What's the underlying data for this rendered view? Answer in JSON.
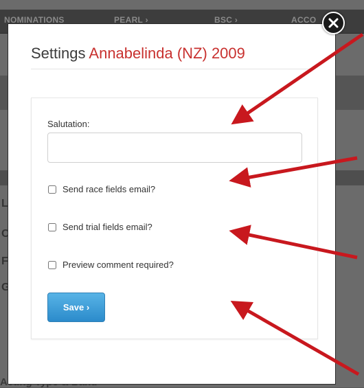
{
  "background": {
    "nav_items": [
      "NOMINATIONS",
      "PEARL ›",
      "BSC ›",
      "ACCO"
    ],
    "footer_text": "Acting Type & Band"
  },
  "modal": {
    "title_prefix": "Settings",
    "horse_name": "Annabelinda (NZ) 2009",
    "salutation_label": "Salutation:",
    "salutation_value": "",
    "checkboxes": [
      {
        "label": "Send race fields email?",
        "checked": false
      },
      {
        "label": "Send trial fields email?",
        "checked": false
      },
      {
        "label": "Preview comment required?",
        "checked": false
      }
    ],
    "save_label": "Save ›"
  },
  "colors": {
    "horse_name": "#c8312f",
    "save_button": "#3a9ad8",
    "annotation_arrow": "#c8181e"
  },
  "icons": {
    "close": "close-icon",
    "arrow": "annotation-arrow"
  }
}
